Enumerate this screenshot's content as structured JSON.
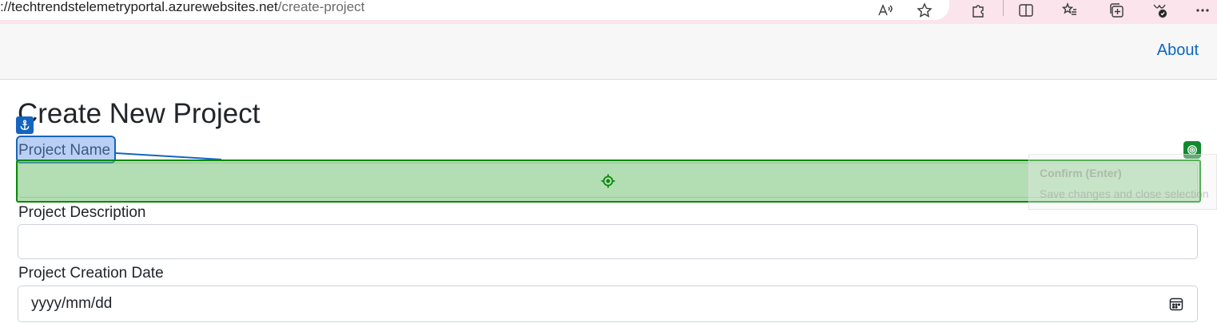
{
  "browser": {
    "url_host": "://techtrendstelemetryportal.azurewebsites.net",
    "url_path": "/create-project",
    "icons": [
      "read-aloud-icon",
      "favorite-star-icon",
      "extensions-icon",
      "split-screen-icon",
      "favorites-icon",
      "collections-icon",
      "browser-essentials-icon",
      "more-icon"
    ]
  },
  "navbar": {
    "about_link": "About"
  },
  "form": {
    "title": "Create New Project",
    "name_label": "Project Name",
    "name_value": "",
    "description_label": "Project Description",
    "description_value": "",
    "date_label": "Project Creation Date",
    "date_placeholder": "yyyy/mm/dd"
  },
  "overlay": {
    "tooltip_title": "Confirm (Enter)",
    "tooltip_subtitle": "Save changes and close selection",
    "colors": {
      "anchor": "#1565c0",
      "target": "#0a8a0a"
    }
  }
}
